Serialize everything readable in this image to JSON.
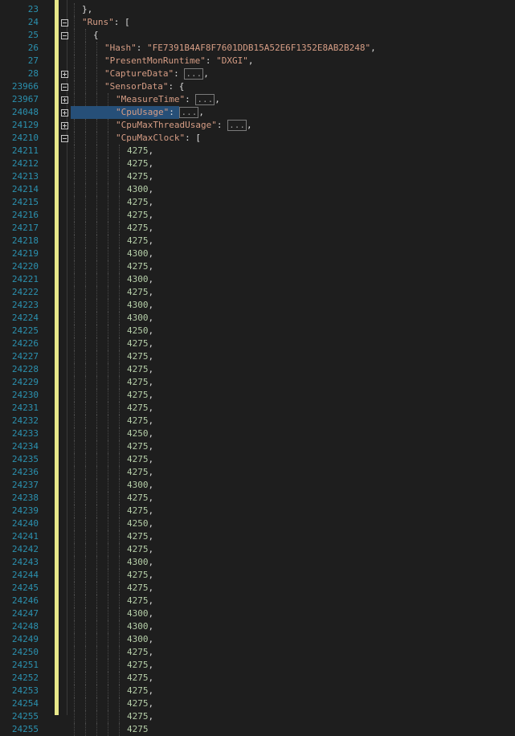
{
  "editor": {
    "header_lines": [
      {
        "num": "23",
        "indent": 1,
        "parts": [
          {
            "t": "},",
            "c": "punc"
          }
        ]
      },
      {
        "num": "24",
        "indent": 1,
        "fold": "minus",
        "parts": [
          {
            "t": "\"Runs\"",
            "c": "key"
          },
          {
            "t": ": [",
            "c": "punc"
          }
        ]
      },
      {
        "num": "25",
        "indent": 2,
        "fold": "minus",
        "parts": [
          {
            "t": "{",
            "c": "punc"
          }
        ]
      },
      {
        "num": "26",
        "indent": 3,
        "parts": [
          {
            "t": "\"Hash\"",
            "c": "key"
          },
          {
            "t": ": ",
            "c": "punc"
          },
          {
            "t": "\"FE7391B4AF8F7601DDB15A52E6F1352E8AB2B248\"",
            "c": "str"
          },
          {
            "t": ",",
            "c": "punc"
          }
        ]
      },
      {
        "num": "27",
        "indent": 3,
        "parts": [
          {
            "t": "\"PresentMonRuntime\"",
            "c": "key"
          },
          {
            "t": ": ",
            "c": "punc"
          },
          {
            "t": "\"DXGI\"",
            "c": "str"
          },
          {
            "t": ",",
            "c": "punc"
          }
        ]
      },
      {
        "num": "28",
        "indent": 3,
        "fold": "plus",
        "parts": [
          {
            "t": "\"CaptureData\"",
            "c": "key"
          },
          {
            "t": ": ",
            "c": "punc"
          },
          {
            "t": "...",
            "c": "collapsed"
          },
          {
            "t": ",",
            "c": "punc"
          }
        ]
      },
      {
        "num": "23966",
        "indent": 3,
        "fold": "minus",
        "parts": [
          {
            "t": "\"SensorData\"",
            "c": "key"
          },
          {
            "t": ": {",
            "c": "punc"
          }
        ]
      },
      {
        "num": "23967",
        "indent": 4,
        "fold": "plus",
        "parts": [
          {
            "t": "\"MeasureTime\"",
            "c": "key"
          },
          {
            "t": ": ",
            "c": "punc"
          },
          {
            "t": "...",
            "c": "collapsed"
          },
          {
            "t": ",",
            "c": "punc"
          }
        ]
      },
      {
        "num": "24048",
        "indent": 4,
        "fold": "plus",
        "selected": true,
        "parts": [
          {
            "t": "\"CpuUsage\"",
            "c": "key"
          },
          {
            "t": ": ",
            "c": "punc"
          },
          {
            "t": "...",
            "c": "collapsed"
          },
          {
            "t": ",",
            "c": "punc"
          }
        ]
      },
      {
        "num": "24129",
        "indent": 4,
        "fold": "plus",
        "parts": [
          {
            "t": "\"CpuMaxThreadUsage\"",
            "c": "key"
          },
          {
            "t": ": ",
            "c": "punc"
          },
          {
            "t": "...",
            "c": "collapsed"
          },
          {
            "t": ",",
            "c": "punc"
          }
        ]
      },
      {
        "num": "24210",
        "indent": 4,
        "fold": "minus",
        "parts": [
          {
            "t": "\"CpuMaxClock\"",
            "c": "key"
          },
          {
            "t": ": [",
            "c": "punc"
          }
        ]
      }
    ],
    "value_start_line": 24211,
    "values": [
      "4275",
      "4275",
      "4275",
      "4300",
      "4275",
      "4275",
      "4275",
      "4275",
      "4300",
      "4275",
      "4300",
      "4275",
      "4300",
      "4300",
      "4250",
      "4275",
      "4275",
      "4275",
      "4275",
      "4275",
      "4275",
      "4275",
      "4250",
      "4275",
      "4275",
      "4275",
      "4300",
      "4275",
      "4275",
      "4250",
      "4275",
      "4275",
      "4300",
      "4275",
      "4275",
      "4275",
      "4300",
      "4300",
      "4300",
      "4275",
      "4275",
      "4275",
      "4275",
      "4275",
      "4275"
    ],
    "last_line_number": "24255"
  }
}
